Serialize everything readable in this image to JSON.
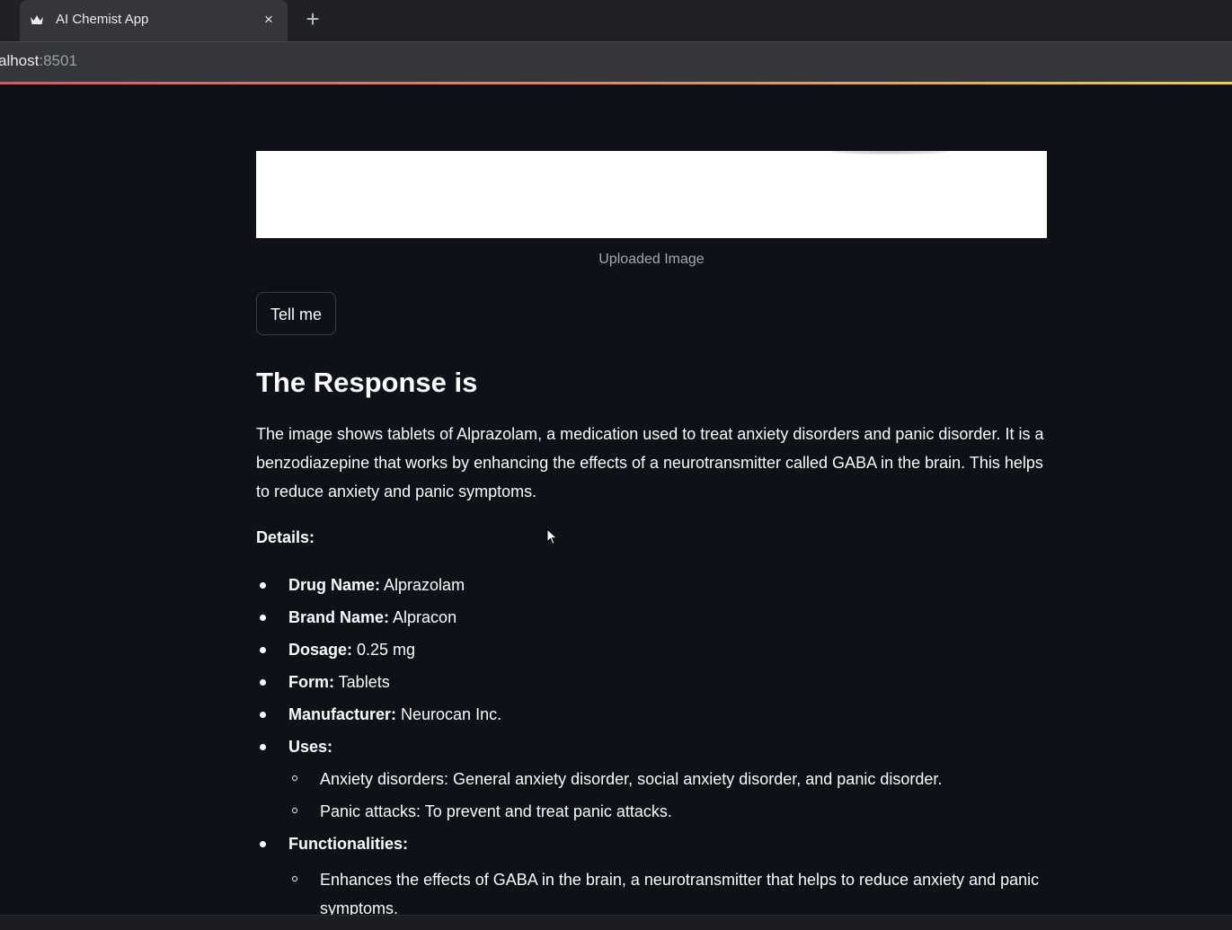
{
  "browser": {
    "tab_title": "AI Chemist App",
    "close_glyph": "×",
    "new_tab_glyph": "+",
    "url_host": "alhost",
    "url_port": ":8501"
  },
  "image": {
    "caption": "Uploaded Image"
  },
  "button": {
    "label": "Tell me"
  },
  "response": {
    "title": "The Response is",
    "paragraph": "The image shows tablets of Alprazolam, a medication used to treat anxiety disorders and panic disorder. It is a benzodiazepine that works by enhancing the effects of a neurotransmitter called GABA in the brain. This helps to reduce anxiety and panic symptoms.",
    "details_label": "Details:",
    "items": [
      {
        "label": "Drug Name:",
        "value": " Alprazolam"
      },
      {
        "label": "Brand Name:",
        "value": " Alpracon"
      },
      {
        "label": "Dosage:",
        "value": " 0.25 mg"
      },
      {
        "label": "Form:",
        "value": " Tablets"
      },
      {
        "label": "Manufacturer:",
        "value": " Neurocan Inc."
      },
      {
        "label": "Uses:",
        "value": ""
      },
      {
        "label": "Functionalities:",
        "value": ""
      }
    ],
    "uses": [
      "Anxiety disorders: General anxiety disorder, social anxiety disorder, and panic disorder.",
      "Panic attacks: To prevent and treat panic attacks."
    ],
    "functionalities": [
      "Enhances the effects of GABA in the brain, a neurotransmitter that helps to reduce anxiety and panic symptoms."
    ]
  },
  "colors": {
    "background": "#0e1117",
    "text": "#fafafa",
    "accent_gradient_start": "#ff4b4b",
    "accent_gradient_end": "#ffd400"
  }
}
